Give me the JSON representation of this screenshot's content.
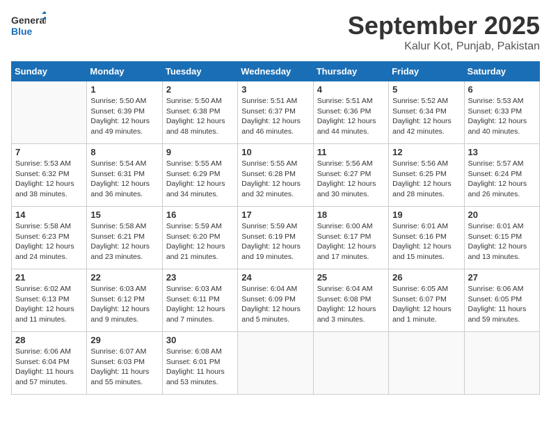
{
  "logo": {
    "general": "General",
    "blue": "Blue"
  },
  "title": "September 2025",
  "location": "Kalur Kot, Punjab, Pakistan",
  "days_of_week": [
    "Sunday",
    "Monday",
    "Tuesday",
    "Wednesday",
    "Thursday",
    "Friday",
    "Saturday"
  ],
  "weeks": [
    [
      {
        "day": "",
        "info": ""
      },
      {
        "day": "1",
        "info": "Sunrise: 5:50 AM\nSunset: 6:39 PM\nDaylight: 12 hours\nand 49 minutes."
      },
      {
        "day": "2",
        "info": "Sunrise: 5:50 AM\nSunset: 6:38 PM\nDaylight: 12 hours\nand 48 minutes."
      },
      {
        "day": "3",
        "info": "Sunrise: 5:51 AM\nSunset: 6:37 PM\nDaylight: 12 hours\nand 46 minutes."
      },
      {
        "day": "4",
        "info": "Sunrise: 5:51 AM\nSunset: 6:36 PM\nDaylight: 12 hours\nand 44 minutes."
      },
      {
        "day": "5",
        "info": "Sunrise: 5:52 AM\nSunset: 6:34 PM\nDaylight: 12 hours\nand 42 minutes."
      },
      {
        "day": "6",
        "info": "Sunrise: 5:53 AM\nSunset: 6:33 PM\nDaylight: 12 hours\nand 40 minutes."
      }
    ],
    [
      {
        "day": "7",
        "info": "Sunrise: 5:53 AM\nSunset: 6:32 PM\nDaylight: 12 hours\nand 38 minutes."
      },
      {
        "day": "8",
        "info": "Sunrise: 5:54 AM\nSunset: 6:31 PM\nDaylight: 12 hours\nand 36 minutes."
      },
      {
        "day": "9",
        "info": "Sunrise: 5:55 AM\nSunset: 6:29 PM\nDaylight: 12 hours\nand 34 minutes."
      },
      {
        "day": "10",
        "info": "Sunrise: 5:55 AM\nSunset: 6:28 PM\nDaylight: 12 hours\nand 32 minutes."
      },
      {
        "day": "11",
        "info": "Sunrise: 5:56 AM\nSunset: 6:27 PM\nDaylight: 12 hours\nand 30 minutes."
      },
      {
        "day": "12",
        "info": "Sunrise: 5:56 AM\nSunset: 6:25 PM\nDaylight: 12 hours\nand 28 minutes."
      },
      {
        "day": "13",
        "info": "Sunrise: 5:57 AM\nSunset: 6:24 PM\nDaylight: 12 hours\nand 26 minutes."
      }
    ],
    [
      {
        "day": "14",
        "info": "Sunrise: 5:58 AM\nSunset: 6:23 PM\nDaylight: 12 hours\nand 24 minutes."
      },
      {
        "day": "15",
        "info": "Sunrise: 5:58 AM\nSunset: 6:21 PM\nDaylight: 12 hours\nand 23 minutes."
      },
      {
        "day": "16",
        "info": "Sunrise: 5:59 AM\nSunset: 6:20 PM\nDaylight: 12 hours\nand 21 minutes."
      },
      {
        "day": "17",
        "info": "Sunrise: 5:59 AM\nSunset: 6:19 PM\nDaylight: 12 hours\nand 19 minutes."
      },
      {
        "day": "18",
        "info": "Sunrise: 6:00 AM\nSunset: 6:17 PM\nDaylight: 12 hours\nand 17 minutes."
      },
      {
        "day": "19",
        "info": "Sunrise: 6:01 AM\nSunset: 6:16 PM\nDaylight: 12 hours\nand 15 minutes."
      },
      {
        "day": "20",
        "info": "Sunrise: 6:01 AM\nSunset: 6:15 PM\nDaylight: 12 hours\nand 13 minutes."
      }
    ],
    [
      {
        "day": "21",
        "info": "Sunrise: 6:02 AM\nSunset: 6:13 PM\nDaylight: 12 hours\nand 11 minutes."
      },
      {
        "day": "22",
        "info": "Sunrise: 6:03 AM\nSunset: 6:12 PM\nDaylight: 12 hours\nand 9 minutes."
      },
      {
        "day": "23",
        "info": "Sunrise: 6:03 AM\nSunset: 6:11 PM\nDaylight: 12 hours\nand 7 minutes."
      },
      {
        "day": "24",
        "info": "Sunrise: 6:04 AM\nSunset: 6:09 PM\nDaylight: 12 hours\nand 5 minutes."
      },
      {
        "day": "25",
        "info": "Sunrise: 6:04 AM\nSunset: 6:08 PM\nDaylight: 12 hours\nand 3 minutes."
      },
      {
        "day": "26",
        "info": "Sunrise: 6:05 AM\nSunset: 6:07 PM\nDaylight: 12 hours\nand 1 minute."
      },
      {
        "day": "27",
        "info": "Sunrise: 6:06 AM\nSunset: 6:05 PM\nDaylight: 11 hours\nand 59 minutes."
      }
    ],
    [
      {
        "day": "28",
        "info": "Sunrise: 6:06 AM\nSunset: 6:04 PM\nDaylight: 11 hours\nand 57 minutes."
      },
      {
        "day": "29",
        "info": "Sunrise: 6:07 AM\nSunset: 6:03 PM\nDaylight: 11 hours\nand 55 minutes."
      },
      {
        "day": "30",
        "info": "Sunrise: 6:08 AM\nSunset: 6:01 PM\nDaylight: 11 hours\nand 53 minutes."
      },
      {
        "day": "",
        "info": ""
      },
      {
        "day": "",
        "info": ""
      },
      {
        "day": "",
        "info": ""
      },
      {
        "day": "",
        "info": ""
      }
    ]
  ]
}
